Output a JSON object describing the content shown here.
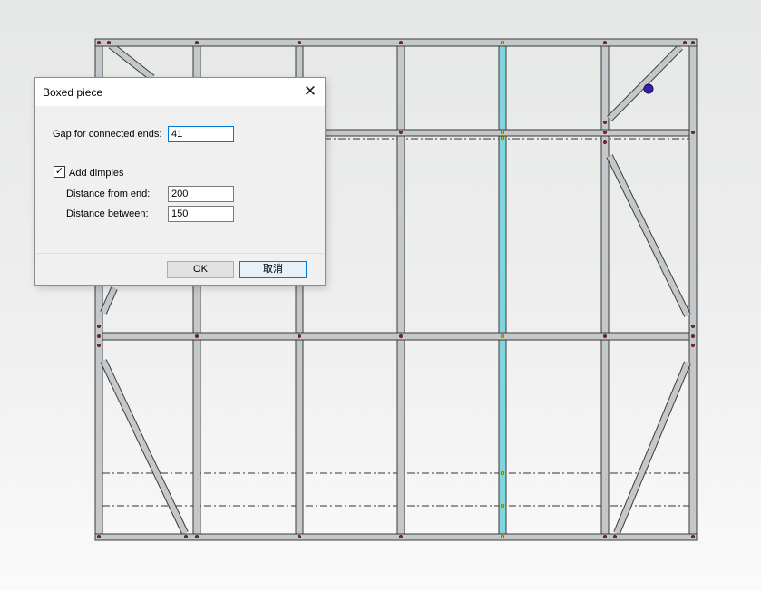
{
  "dialog": {
    "title": "Boxed piece",
    "close_icon": "close-icon",
    "gap_label": "Gap for connected ends:",
    "gap_value": "41",
    "dimples_checked": true,
    "dimples_label": "Add dimples",
    "distance_from_end_label": "Distance from end:",
    "distance_from_end_value": "200",
    "distance_between_label": "Distance between:",
    "distance_between_value": "150",
    "ok_label": "OK",
    "cancel_label": "取消"
  },
  "colors": {
    "member_fill": "#c4c8cb",
    "member_stroke": "#3a3a3a",
    "highlight_stud": "#7fd6dc",
    "selection_point": "#3a21a8",
    "hole_dot": "#8a2020",
    "yellow_dot": "#d8d000"
  }
}
